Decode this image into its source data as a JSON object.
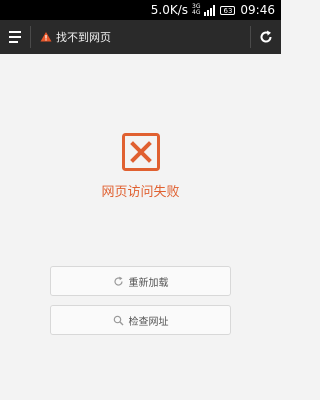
{
  "status_bar": {
    "speed": "5.0K/s",
    "network_type_top": "3G",
    "network_type_bottom": "4G",
    "battery": "63",
    "time": "09:46"
  },
  "toolbar": {
    "page_title": "找不到网页",
    "warning_icon": "warning-icon",
    "menu_icon": "menu-icon",
    "refresh_icon": "refresh-icon"
  },
  "error": {
    "icon": "error-x-icon",
    "message": "网页访问失败",
    "accent_color": "#e06030"
  },
  "actions": {
    "reload_label": "重新加载",
    "reload_icon": "refresh-icon",
    "check_url_label": "检查网址",
    "check_url_icon": "search-icon"
  }
}
